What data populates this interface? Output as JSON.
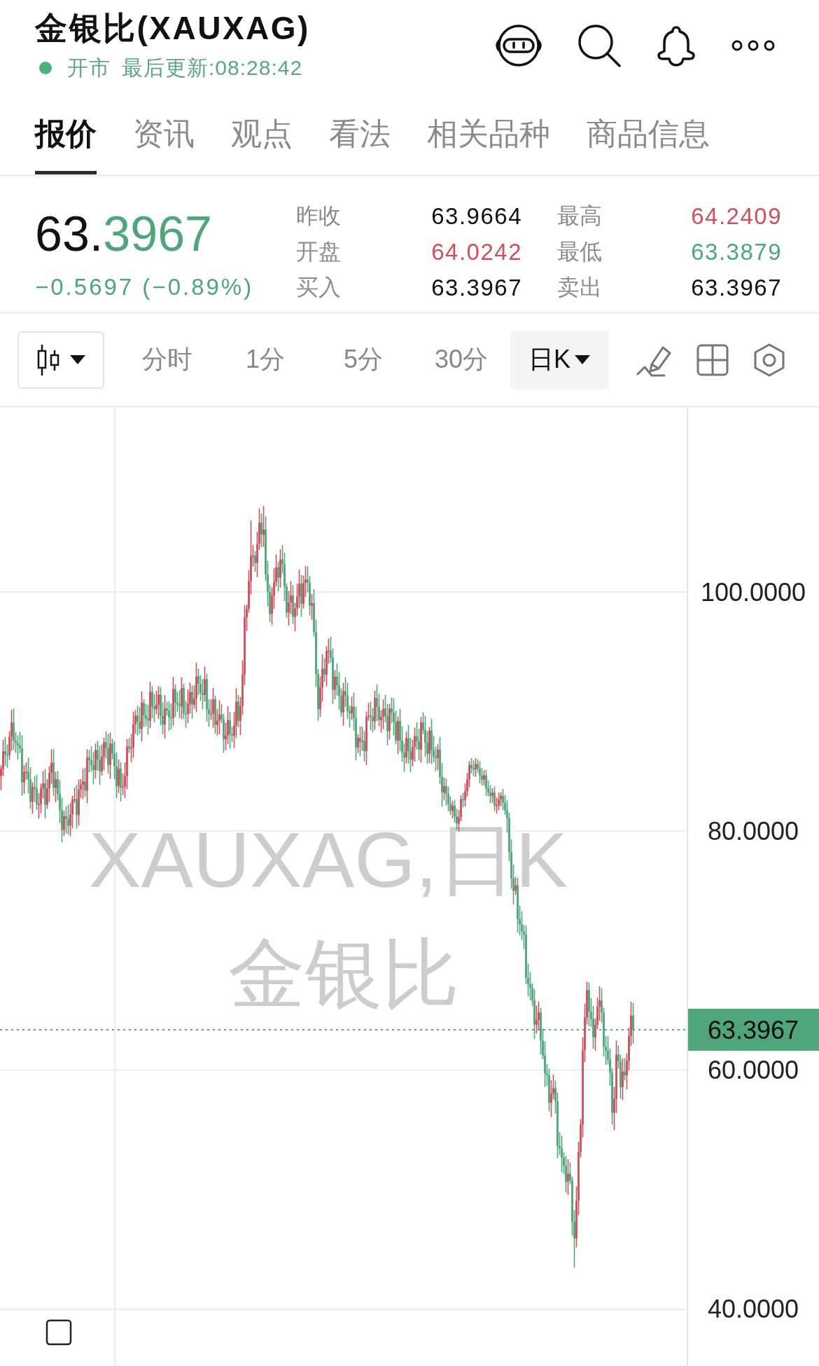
{
  "header": {
    "title": "金银比(XAUXAG)",
    "market_open": true,
    "market_status": "开市",
    "last_update": "最后更新:08:28:42"
  },
  "tabs": [
    {
      "label": "报价",
      "selected": true
    },
    {
      "label": "资讯",
      "selected": false
    },
    {
      "label": "观点",
      "selected": false
    },
    {
      "label": "看法",
      "selected": false
    },
    {
      "label": "相关品种",
      "selected": false
    },
    {
      "label": "商品信息",
      "selected": false
    }
  ],
  "quote": {
    "price_whole": "63.",
    "price_fraction": "3967",
    "falling": true,
    "change": "−0.5697 (−0.89%)",
    "stats": [
      {
        "label": "昨收",
        "value": "63.9664",
        "color": "#111111"
      },
      {
        "label": "最高",
        "value": "64.2409",
        "color": "#cf4f5c"
      },
      {
        "label": "开盘",
        "value": "64.0242",
        "color": "#cf4f5c"
      },
      {
        "label": "最低",
        "value": "63.3879",
        "color": "#4fa67a"
      },
      {
        "label": "买入",
        "value": "63.3967",
        "color": "#111111"
      },
      {
        "label": "卖出",
        "value": "63.3967",
        "color": "#111111"
      }
    ]
  },
  "toolbar": {
    "intervals": [
      {
        "label": "分时",
        "selected": false,
        "menu": false
      },
      {
        "label": "1分",
        "selected": false,
        "menu": false
      },
      {
        "label": "5分",
        "selected": false,
        "menu": false
      },
      {
        "label": "30分",
        "selected": false,
        "menu": false
      },
      {
        "label": "日K",
        "selected": true,
        "menu": true
      }
    ]
  },
  "chart": {
    "y_ticks": [
      "100.0000",
      "80.0000",
      "60.0000",
      "40.0000"
    ],
    "last_price": "63.3967",
    "watermark": [
      "XAUXAG,日K",
      "金银比"
    ]
  }
}
